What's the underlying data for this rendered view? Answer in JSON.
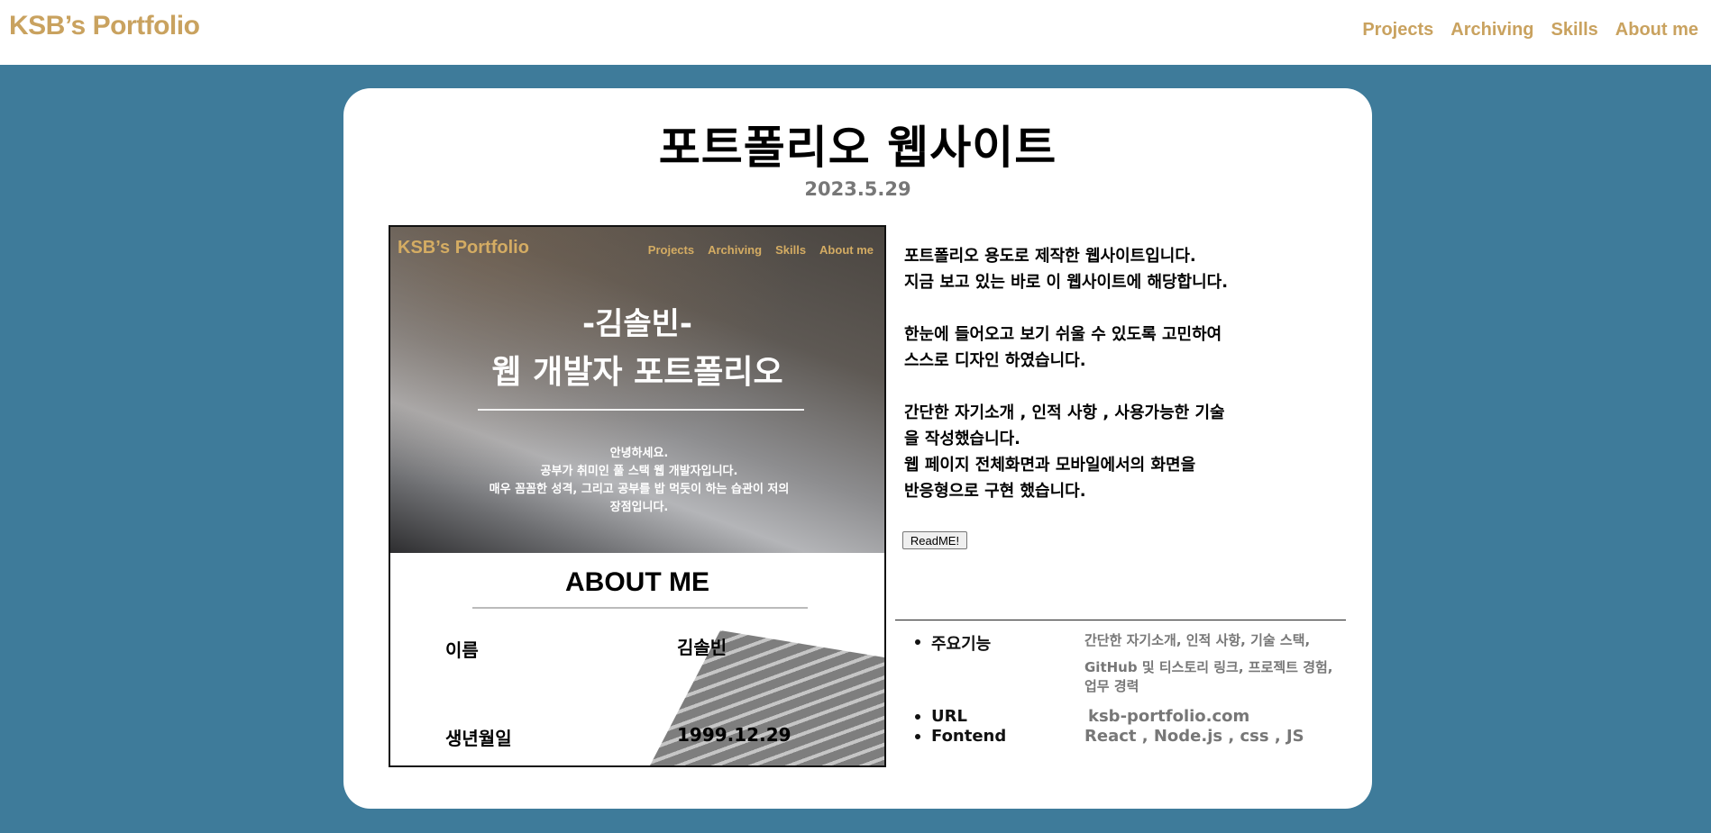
{
  "navbar": {
    "brand": "KSB’s Portfolio",
    "links": [
      "Projects",
      "Archiving",
      "Skills",
      "About me"
    ]
  },
  "project": {
    "title": "포트폴리오 웹사이트",
    "date": "2023.5.29",
    "preview": {
      "brand": "KSB’s Portfolio",
      "nav": [
        "Projects",
        "Archiving",
        "Skills",
        "About me"
      ],
      "hero_name": "-김솔빈-",
      "hero_title": "웹 개발자 포트폴리오",
      "hero_intro": [
        "안녕하세요.",
        "공부가 취미인 풀 스택 웹 개발자입니다.",
        "매우 꼼꼼한 성격, 그리고 공부를 밥 먹듯이 하는 습관이 저의",
        "장점입니다."
      ],
      "about_title": "ABOUT ME",
      "rows": [
        {
          "label": "이름",
          "value": "김솔빈"
        },
        {
          "label": "생년월일",
          "value": "1999.12.29"
        }
      ]
    },
    "description": [
      "포트폴리오 용도로 제작한 웹사이트입니다.\n지금 보고 있는 바로 이 웹사이트에 해당합니다.",
      "한눈에 들어오고 보기 쉬울 수 있도록 고민하여\n스스로 디자인 하였습니다.",
      "간단한 자기소개 , 인적 사항 , 사용가능한 기술\n을 작성했습니다.\n웹 페이지 전체화면과 모바일에서의 화면을\n반응형으로 구현 했습니다."
    ],
    "readme_label": "ReadME!",
    "info": [
      {
        "label": "주요기능",
        "value": "간단한 자기소개, 인적 사항, 기술 스택,",
        "value2": "GitHub 및 티스토리 링크, 프로젝트 경험,",
        "value3": " 업무 경력"
      },
      {
        "label": "URL",
        "value": "ksb-portfolio.com"
      },
      {
        "label": "Fontend",
        "value": " React , Node.js , css , JS"
      }
    ]
  }
}
